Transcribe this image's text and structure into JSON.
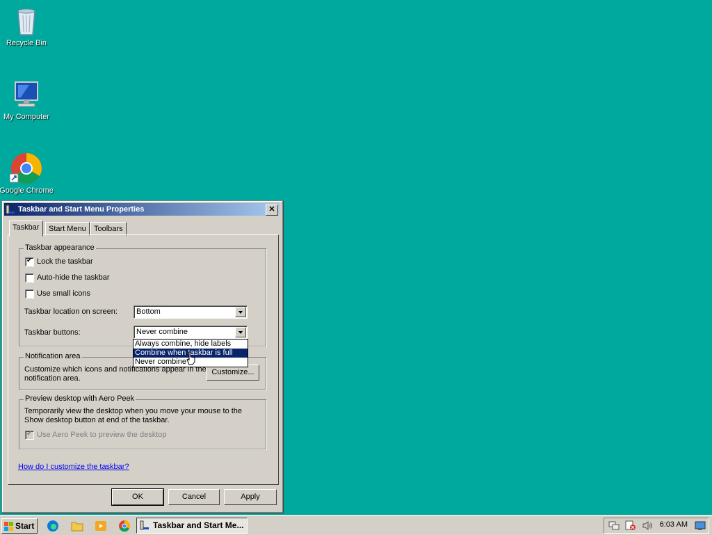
{
  "desktop": {
    "icons": [
      {
        "label": "Recycle Bin"
      },
      {
        "label": "My Computer"
      },
      {
        "label": "Google Chrome"
      }
    ]
  },
  "dialog": {
    "title": "Taskbar and Start Menu Properties",
    "close_glyph": "✕",
    "tabs": [
      "Taskbar",
      "Start Menu",
      "Toolbars"
    ],
    "appearance": {
      "title": "Taskbar appearance",
      "lock": {
        "label": "Lock the taskbar",
        "checked": true
      },
      "autohide": {
        "label": "Auto-hide the taskbar",
        "checked": false
      },
      "small_icons": {
        "label": "Use small icons",
        "checked": false
      },
      "location_label": "Taskbar location on screen:",
      "location_value": "Bottom",
      "buttons_label": "Taskbar buttons:",
      "buttons_value": "Never combine",
      "buttons_options": [
        "Always combine, hide labels",
        "Combine when taskbar is full",
        "Never combine"
      ],
      "buttons_highlighted": "Combine when taskbar is full"
    },
    "notification": {
      "title": "Notification area",
      "desc_line1": "Customize which icons and notifications appear in the",
      "desc_line2": "notification area.",
      "customize_button": "Customize..."
    },
    "aero": {
      "title": "Preview desktop with Aero Peek",
      "desc_line1": "Temporarily view the desktop when you move your mouse to the",
      "desc_line2": "Show desktop button at end of the taskbar.",
      "checkbox": {
        "label": "Use Aero Peek to preview the desktop",
        "checked": true,
        "disabled": true
      }
    },
    "help_link": "How do I customize the taskbar?",
    "buttons": {
      "ok": "OK",
      "cancel": "Cancel",
      "apply": "Apply"
    }
  },
  "taskbar": {
    "start_label": "Start",
    "quicklaunch": [
      "edge-icon",
      "folder-icon",
      "media-player-icon",
      "chrome-icon"
    ],
    "active_window": "Taskbar and Start Me...",
    "clock": "6:03 AM"
  },
  "colors": {
    "desktop": "#00a99d",
    "dialog_face": "#d4d0c8",
    "titlebar_start": "#0a246a",
    "titlebar_end": "#a6caf0",
    "selection": "#0a246a"
  }
}
